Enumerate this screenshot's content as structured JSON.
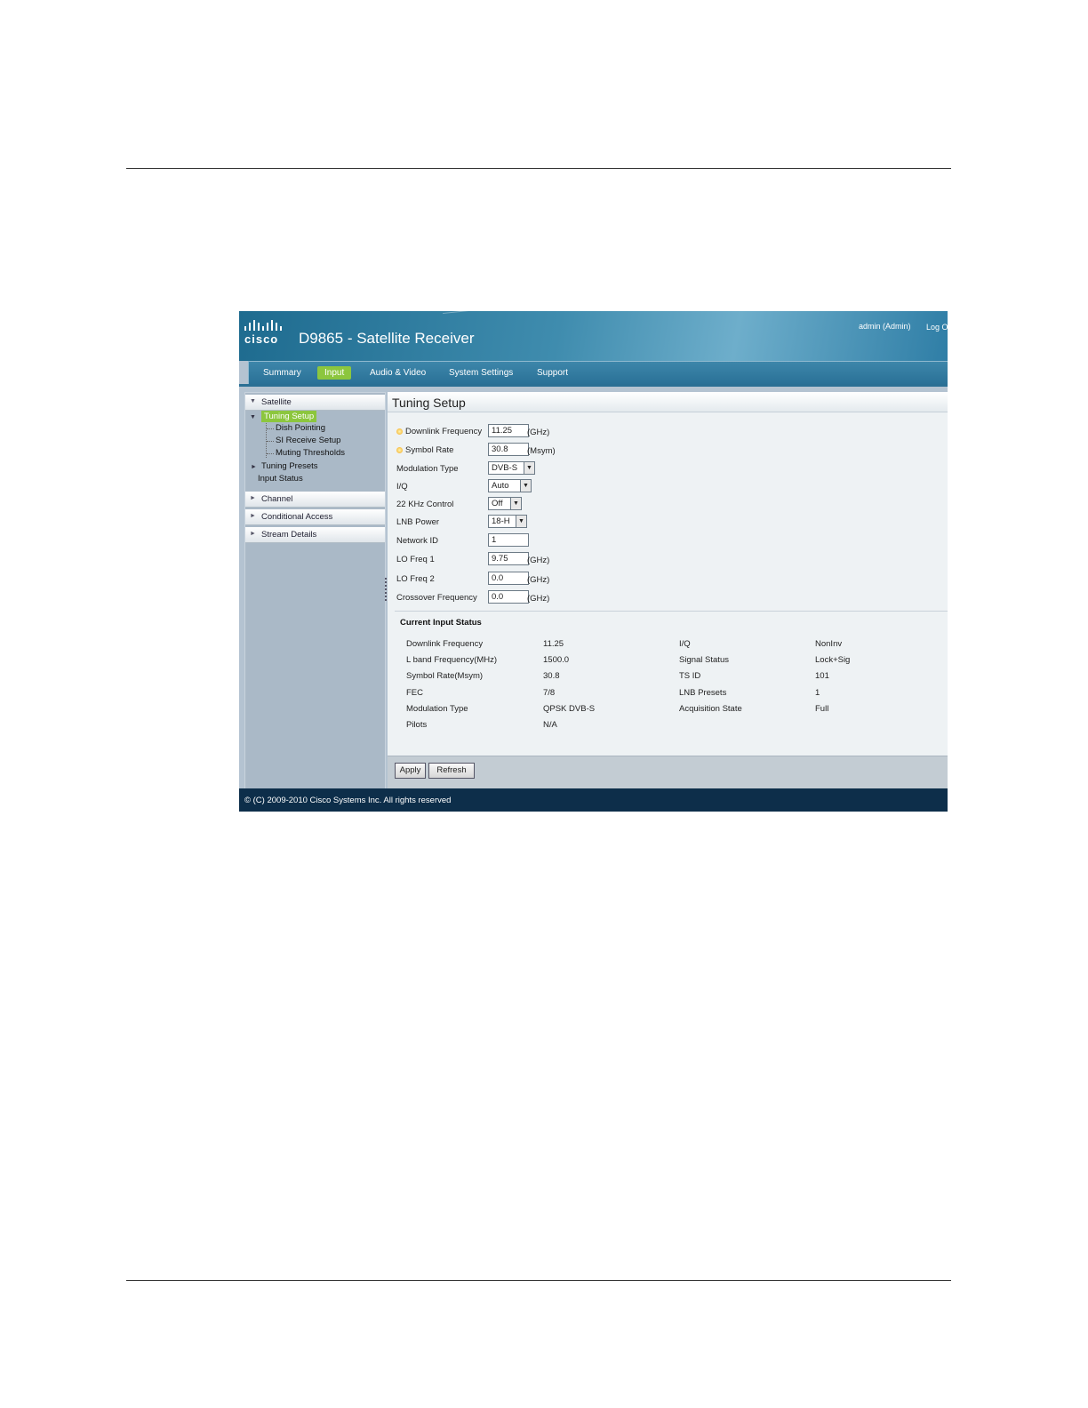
{
  "header": {
    "logo_text": "cisco",
    "title": "D9865 - Satellite Receiver",
    "user": "admin (Admin)",
    "logout": "Log O"
  },
  "nav": {
    "tabs": [
      "Summary",
      "Input",
      "Audio & Video",
      "System Settings",
      "Support"
    ],
    "active": "Input"
  },
  "sidebar": {
    "satellite": "Satellite",
    "tuning_setup": "Tuning Setup",
    "dish_pointing": "Dish Pointing",
    "si_receive_setup": "SI Receive Setup",
    "muting_thresholds": "Muting Thresholds",
    "tuning_presets": "Tuning Presets",
    "input_status": "Input Status",
    "channel": "Channel",
    "conditional_access": "Conditional Access",
    "stream_details": "Stream Details"
  },
  "main": {
    "title": "Tuning Setup",
    "fields": {
      "downlink_frequency": {
        "label": "Downlink Frequency",
        "value": "11.25",
        "unit": "(GHz)"
      },
      "symbol_rate": {
        "label": "Symbol Rate",
        "value": "30.8",
        "unit": "(Msym)"
      },
      "modulation_type": {
        "label": "Modulation Type",
        "value": "DVB-S"
      },
      "iq": {
        "label": "I/Q",
        "value": "Auto"
      },
      "khz_control": {
        "label": "22 KHz Control",
        "value": "Off"
      },
      "lnb_power": {
        "label": "LNB Power",
        "value": "18-H"
      },
      "network_id": {
        "label": "Network ID",
        "value": "1"
      },
      "lo_freq_1": {
        "label": "LO Freq 1",
        "value": "9.75",
        "unit": "(GHz)"
      },
      "lo_freq_2": {
        "label": "LO Freq 2",
        "value": "0.0",
        "unit": "(GHz)"
      },
      "crossover_frequency": {
        "label": "Crossover Frequency",
        "value": "0.0",
        "unit": "(GHz)"
      }
    },
    "status_title": "Current Input Status",
    "status_left": [
      {
        "label": "Downlink Frequency",
        "value": "11.25"
      },
      {
        "label": "L band Frequency(MHz)",
        "value": "1500.0"
      },
      {
        "label": "Symbol Rate(Msym)",
        "value": "30.8"
      },
      {
        "label": "FEC",
        "value": "7/8"
      },
      {
        "label": "Modulation Type",
        "value": "QPSK DVB-S"
      },
      {
        "label": "Pilots",
        "value": "N/A"
      }
    ],
    "status_right": [
      {
        "label": "I/Q",
        "value": "NonInv"
      },
      {
        "label": "Signal Status",
        "value": "Lock+Sig"
      },
      {
        "label": "TS ID",
        "value": "101"
      },
      {
        "label": "LNB Presets",
        "value": "1"
      },
      {
        "label": "Acquisition State",
        "value": "Full"
      }
    ],
    "apply": "Apply",
    "refresh": "Refresh"
  },
  "footer": {
    "copyright": "© (C) 2009-2010 Cisco Systems Inc. All rights reserved"
  }
}
